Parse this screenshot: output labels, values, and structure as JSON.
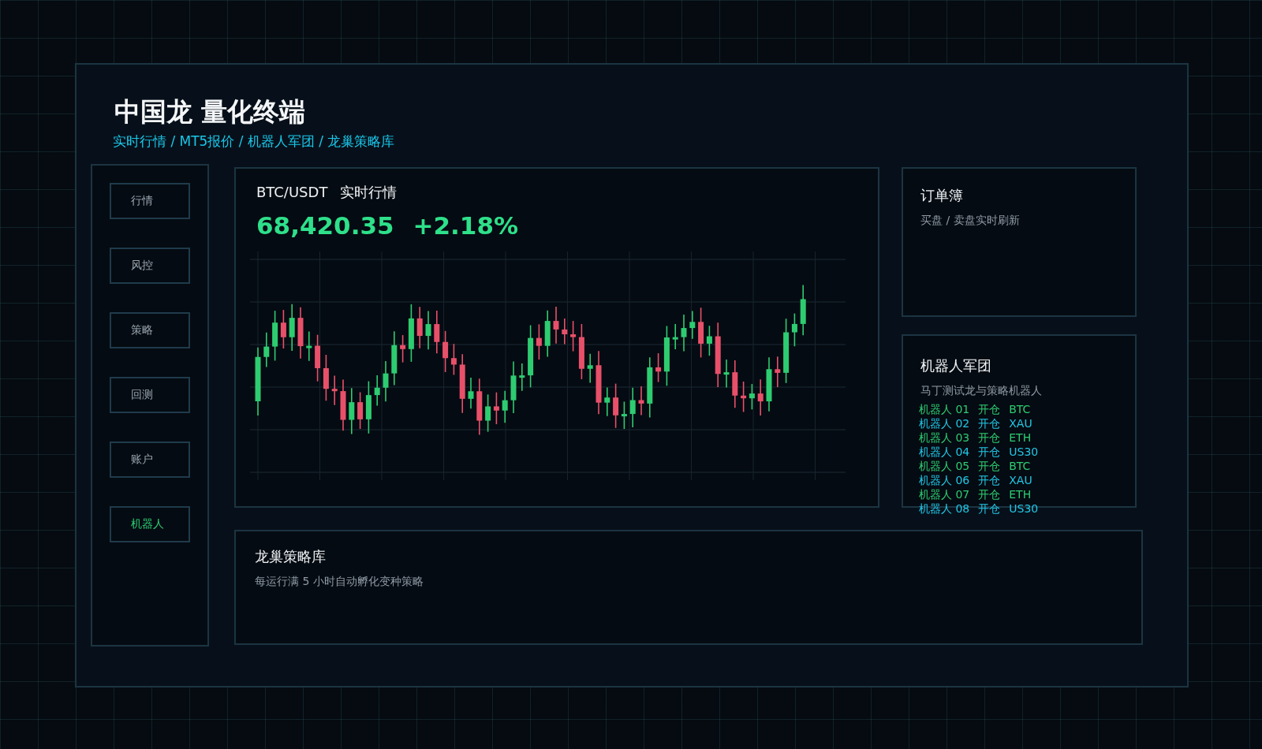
{
  "header": {
    "title": "中国龙 量化终端",
    "subtitle": "实时行情 / MT5报价 / 机器人军团 / 龙巢策略库"
  },
  "sidebar": {
    "items": [
      {
        "label": "行情",
        "selected": false
      },
      {
        "label": "风控",
        "selected": false
      },
      {
        "label": "策略",
        "selected": false
      },
      {
        "label": "回测",
        "selected": false
      },
      {
        "label": "账户",
        "selected": false
      },
      {
        "label": "机器人",
        "selected": true
      }
    ]
  },
  "market": {
    "symbol": "BTC/USDT",
    "title": "实时行情",
    "price": "68,420.35",
    "change": "+2.18%"
  },
  "order_book": {
    "title": "订单簿",
    "subtitle": "买盘 / 卖盘实时刷新"
  },
  "robots": {
    "title": "机器人军团",
    "subtitle": "马丁测试龙与策略机器人",
    "items": [
      {
        "name": "机器人 01",
        "action": "开仓",
        "symbol": "BTC",
        "color": "#2ecc71"
      },
      {
        "name": "机器人 02",
        "action": "开仓",
        "symbol": "XAU",
        "color": "#22c7e6"
      },
      {
        "name": "机器人 03",
        "action": "开仓",
        "symbol": "ETH",
        "color": "#2ecc71"
      },
      {
        "name": "机器人 04",
        "action": "开仓",
        "symbol": "US30",
        "color": "#22c7e6"
      },
      {
        "name": "机器人 05",
        "action": "开仓",
        "symbol": "BTC",
        "color": "#2ecc71"
      },
      {
        "name": "机器人 06",
        "action": "开仓",
        "symbol": "XAU",
        "color": "#22c7e6"
      },
      {
        "name": "机器人 07",
        "action": "开仓",
        "symbol": "ETH",
        "color": "#2ecc71"
      },
      {
        "name": "机器人 08",
        "action": "开仓",
        "symbol": "US30",
        "color": "#22c7e6"
      }
    ]
  },
  "strategy": {
    "title": "龙巢策略库",
    "subtitle": "每运行满 5 小时自动孵化变种策略"
  }
}
